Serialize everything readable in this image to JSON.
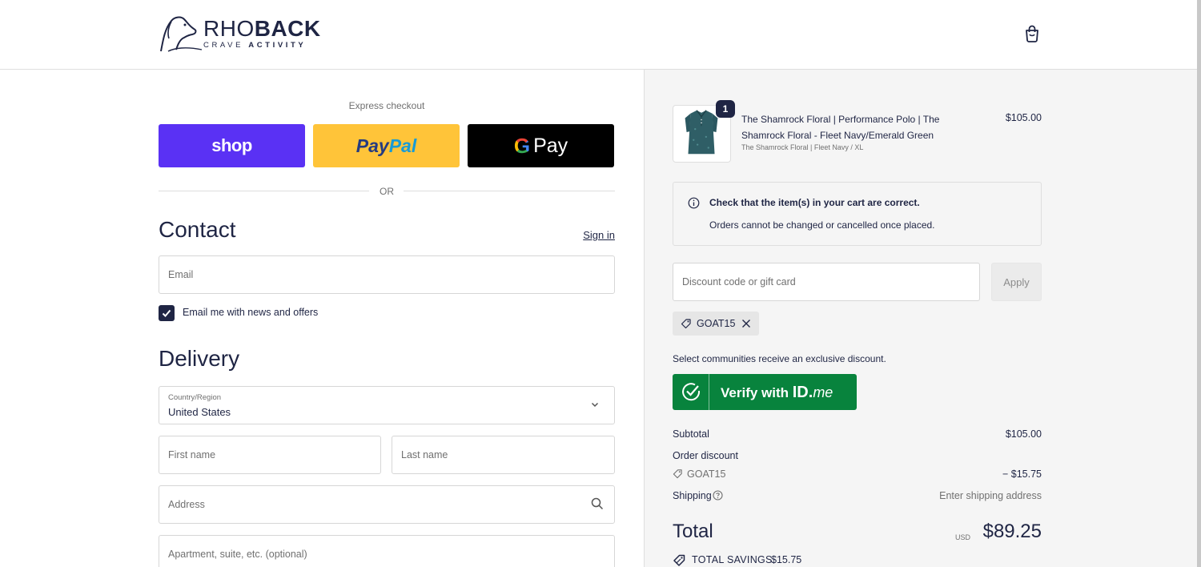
{
  "brand": {
    "name_light": "RHO",
    "name_bold": "BACK",
    "tagline_light": "CRAVE ",
    "tagline_bold": "ACTIVITY"
  },
  "express": {
    "label": "Express checkout",
    "shop_label": "shop",
    "paypal_part1": "Pay",
    "paypal_part2": "Pal",
    "gpay_g": "G",
    "gpay_label": "Pay",
    "or": "OR"
  },
  "contact": {
    "heading": "Contact",
    "sign_in": "Sign in",
    "email_placeholder": "Email",
    "newsletter_label": "Email me with news and offers",
    "newsletter_checked": true
  },
  "delivery": {
    "heading": "Delivery",
    "country_label": "Country/Region",
    "country_value": "United States",
    "first_name_placeholder": "First name",
    "last_name_placeholder": "Last name",
    "address_placeholder": "Address",
    "apartment_placeholder": "Apartment, suite, etc. (optional)"
  },
  "cart": {
    "quantity": "1",
    "product_title": "The Shamrock Floral | Performance Polo | The Shamrock Floral - Fleet Navy/Emerald Green",
    "product_variant": "The Shamrock Floral | Fleet Navy / XL",
    "product_price": "$105.00"
  },
  "notice": {
    "title": "Check that the item(s) in your cart are correct.",
    "body": "Orders cannot be changed or cancelled once placed."
  },
  "discount": {
    "placeholder": "Discount code or gift card",
    "apply_label": "Apply",
    "applied_code": "GOAT15"
  },
  "idme": {
    "communities_text": "Select communities receive an exclusive discount.",
    "verify_label": "Verify with ",
    "id_bold": "ID.",
    "id_italic": "me"
  },
  "summary": {
    "subtotal_label": "Subtotal",
    "subtotal_value": "$105.00",
    "order_discount_label": "Order discount",
    "discount_code": "GOAT15",
    "discount_value": "− $15.75",
    "shipping_label": "Shipping",
    "shipping_value": "Enter shipping address",
    "total_label": "Total",
    "currency": "USD",
    "total_value": "$89.25",
    "savings_label": "TOTAL SAVINGS",
    "savings_value": "$15.75"
  },
  "colors": {
    "navy": "#1f2544",
    "shop_purple": "#5a31f4",
    "paypal_yellow": "#ffc439",
    "idme_green": "#08833d",
    "panel_gray": "#f5f5f5"
  }
}
